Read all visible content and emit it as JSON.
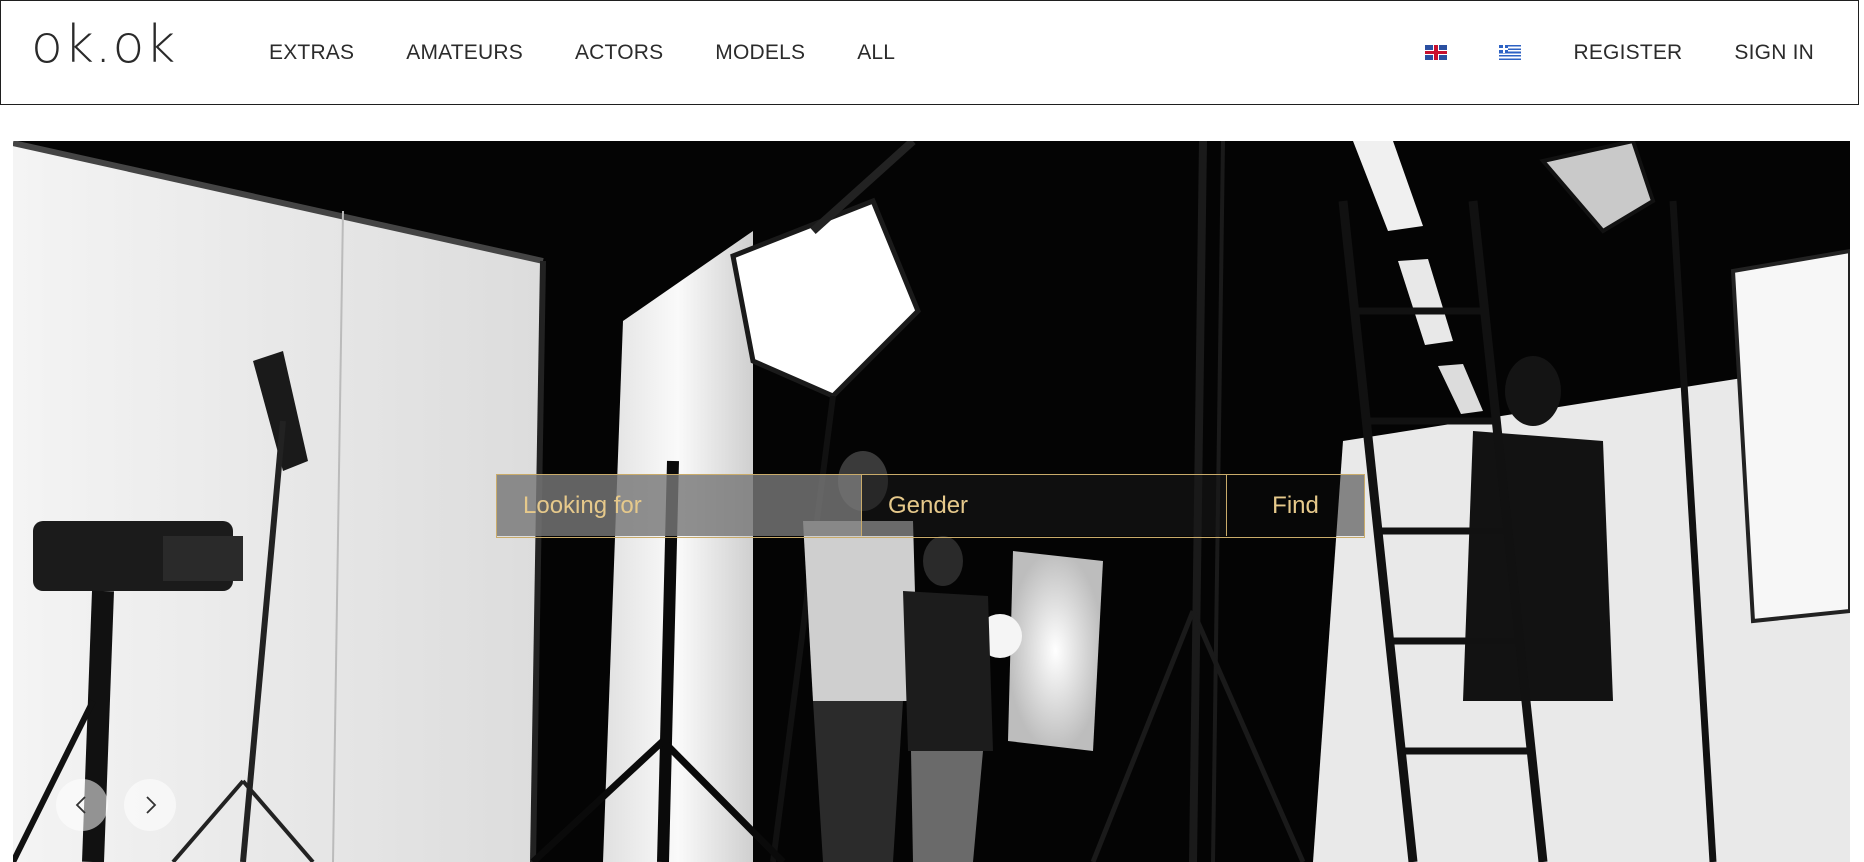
{
  "header": {
    "logo": "ok.ok",
    "nav": [
      {
        "label": "EXTRAS"
      },
      {
        "label": "AMATEURS"
      },
      {
        "label": "ACTORS"
      },
      {
        "label": "MODELS"
      },
      {
        "label": "ALL"
      }
    ],
    "languages": [
      {
        "icon": "uk-flag-icon"
      },
      {
        "icon": "greek-flag-icon"
      }
    ],
    "register_label": "REGISTER",
    "signin_label": "SIGN IN"
  },
  "search": {
    "looking_for": "Looking for",
    "gender": "Gender",
    "find_label": "Find"
  },
  "carousel": {
    "prev_icon": "chevron-left-icon",
    "next_icon": "chevron-right-icon"
  },
  "colors": {
    "accent_gold": "#c9ab6a",
    "text_gold": "#e6c98b",
    "header_border": "#1f1f1f"
  }
}
